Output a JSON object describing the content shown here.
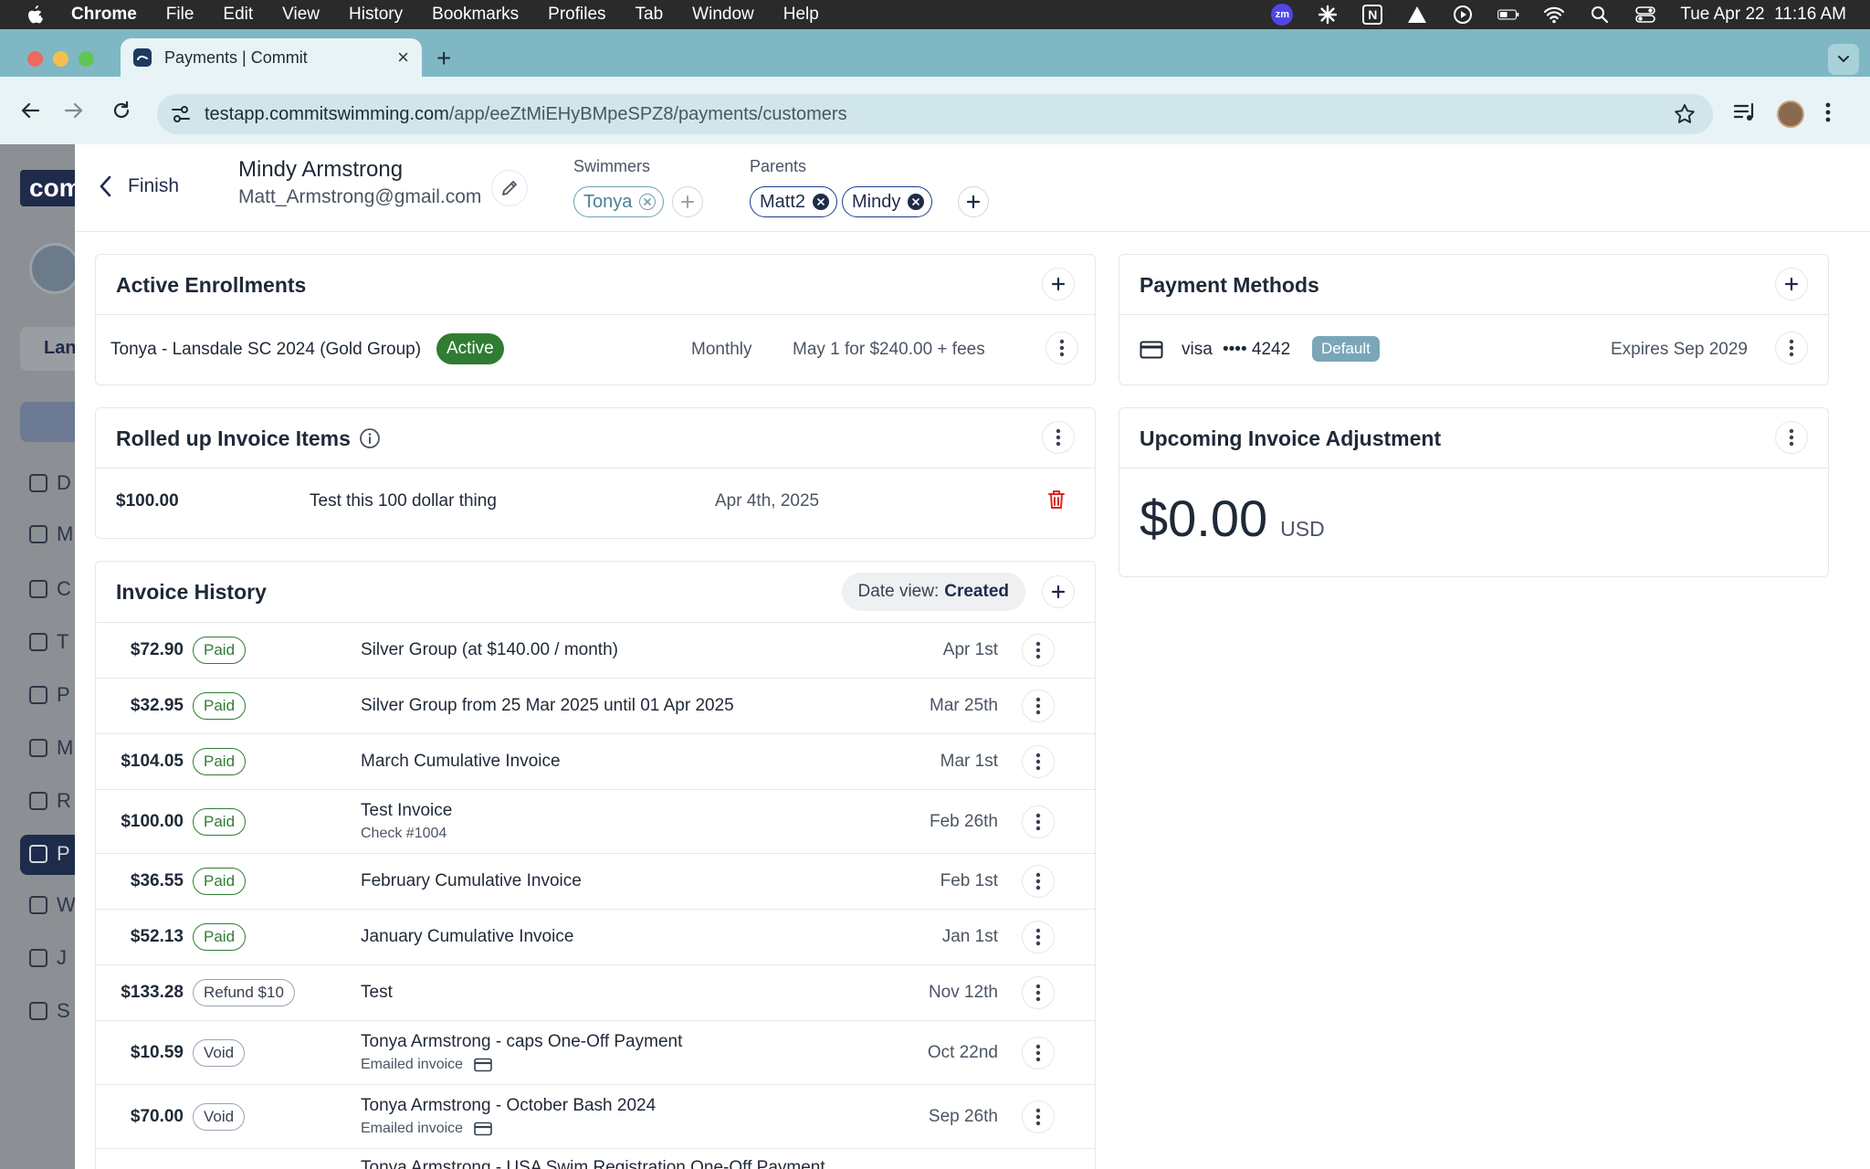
{
  "menubar": {
    "app": "Chrome",
    "items": [
      "File",
      "Edit",
      "View",
      "History",
      "Bookmarks",
      "Profiles",
      "Tab",
      "Window",
      "Help"
    ],
    "clock": "Tue Apr 22  11:16 AM",
    "zoom_label": "zm",
    "notion_label": "N"
  },
  "browser": {
    "tab_title": "Payments | Commit",
    "url_host": "testapp.commitswimming.com",
    "url_path": "/app/eeZtMiEHyBMpeSPZ8/payments/customers"
  },
  "background_app": {
    "logo": "com",
    "pill": "Lan",
    "nav_letters": [
      "D",
      "M",
      "C",
      "T",
      "P",
      "M",
      "R",
      "P",
      "W",
      "J",
      "S"
    ]
  },
  "header": {
    "finish_label": "Finish",
    "customer_name": "Mindy Armstrong",
    "customer_email": "Matt_Armstrong@gmail.com",
    "swimmers_label": "Swimmers",
    "swimmers": [
      "Tonya"
    ],
    "parents_label": "Parents",
    "parents": [
      "Matt2",
      "Mindy"
    ]
  },
  "enrollments": {
    "title": "Active Enrollments",
    "items": [
      {
        "name": "Tonya - Lansdale SC 2024 (Gold Group)",
        "status": "Active",
        "frequency": "Monthly",
        "next": "May 1 for $240.00 + fees"
      }
    ]
  },
  "rolled_up": {
    "title": "Rolled up Invoice Items",
    "items": [
      {
        "amount": "$100.00",
        "description": "Test this 100 dollar thing",
        "date": "Apr 4th, 2025"
      }
    ]
  },
  "invoice_history": {
    "title": "Invoice History",
    "date_view_label": "Date view:",
    "date_view_value": "Created",
    "rows": [
      {
        "amount": "$72.90",
        "status": "Paid",
        "kind": "paid",
        "description": "Silver Group (at $140.00 / month)",
        "sub": "",
        "date": "Apr 1st"
      },
      {
        "amount": "$32.95",
        "status": "Paid",
        "kind": "paid",
        "description": "Silver Group from 25 Mar 2025 until 01 Apr 2025",
        "sub": "",
        "date": "Mar 25th"
      },
      {
        "amount": "$104.05",
        "status": "Paid",
        "kind": "paid",
        "description": "March Cumulative Invoice",
        "sub": "",
        "date": "Mar 1st"
      },
      {
        "amount": "$100.00",
        "status": "Paid",
        "kind": "paid",
        "description": "Test Invoice",
        "sub": "Check #1004",
        "date": "Feb 26th"
      },
      {
        "amount": "$36.55",
        "status": "Paid",
        "kind": "paid",
        "description": "February Cumulative Invoice",
        "sub": "",
        "date": "Feb 1st"
      },
      {
        "amount": "$52.13",
        "status": "Paid",
        "kind": "paid",
        "description": "January Cumulative Invoice",
        "sub": "",
        "date": "Jan 1st"
      },
      {
        "amount": "$133.28",
        "status": "Refund $10",
        "kind": "gray",
        "description": "Test",
        "sub": "",
        "date": "Nov 12th"
      },
      {
        "amount": "$10.59",
        "status": "Void",
        "kind": "gray",
        "description": "Tonya Armstrong - caps One-Off Payment",
        "sub": "Emailed invoice",
        "date": "Oct 22nd"
      },
      {
        "amount": "$70.00",
        "status": "Void",
        "kind": "gray",
        "description": "Tonya Armstrong - October Bash 2024",
        "sub": "Emailed invoice",
        "date": "Sep 26th"
      },
      {
        "amount": "",
        "status": "",
        "kind": "gray",
        "description": "Tonya Armstrong - USA Swim Registration One-Off Payment",
        "sub": "",
        "date": ""
      }
    ]
  },
  "payment_methods": {
    "title": "Payment Methods",
    "items": [
      {
        "brand": "visa",
        "masked": "•••• 4242",
        "badge": "Default",
        "expires": "Expires Sep 2029"
      }
    ]
  },
  "adjustment": {
    "title": "Upcoming Invoice Adjustment",
    "amount": "$0.00",
    "currency": "USD"
  }
}
